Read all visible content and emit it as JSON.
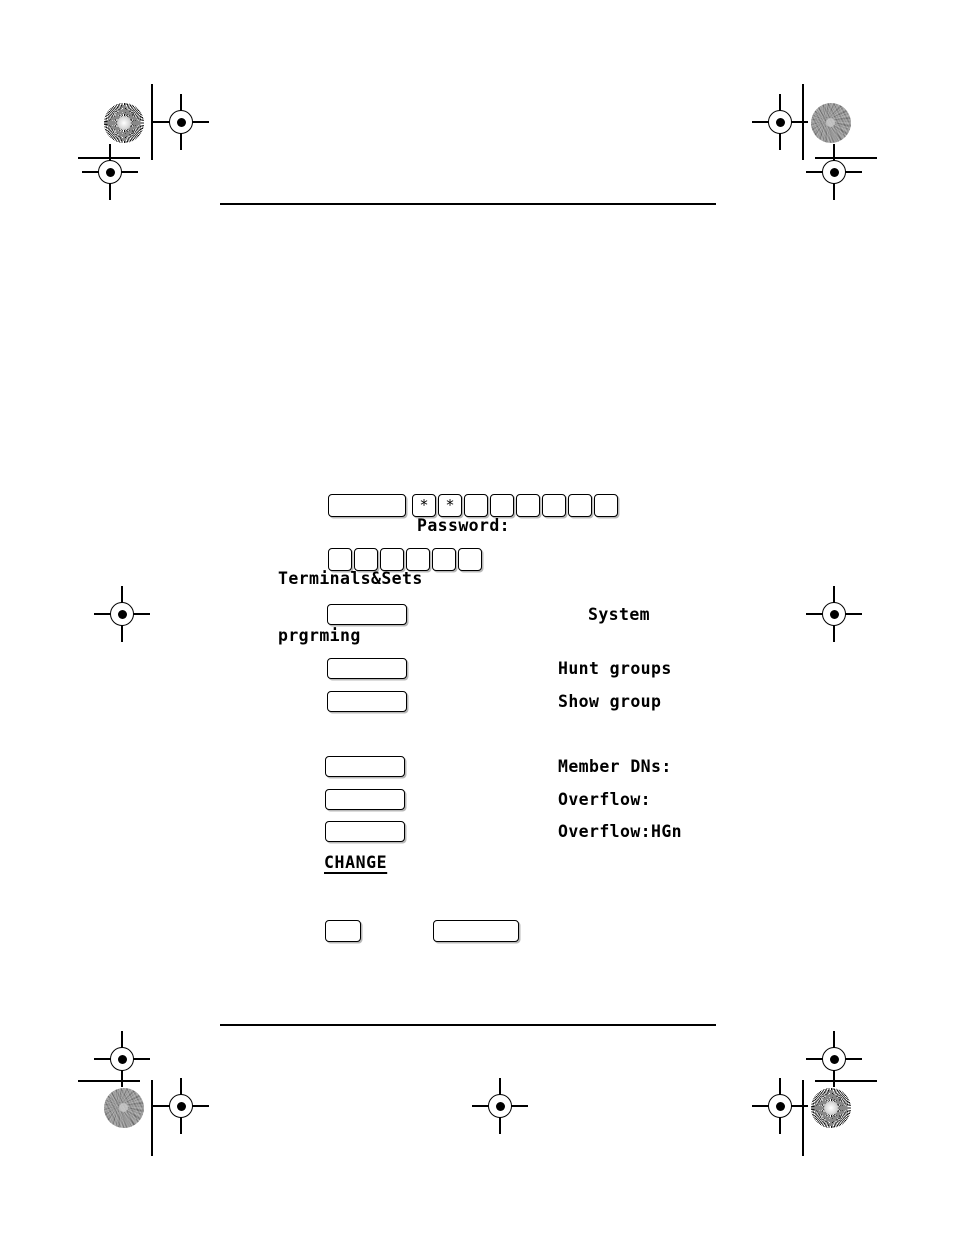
{
  "page": {
    "type": "programming-flow-diagram",
    "rules": {
      "top_label": "header-rule",
      "bottom_label": "footer-rule"
    }
  },
  "flow": {
    "password_row": {
      "feature_key_label": "",
      "digit_keys": [
        "*",
        "*",
        "",
        "",
        "",
        "",
        "",
        ""
      ],
      "display": "Password:"
    },
    "code_row": {
      "digit_keys": [
        "",
        "",
        "",
        "",
        "",
        ""
      ],
      "display": "Terminals&Sets"
    },
    "steps": [
      {
        "key_label": "",
        "display": "System",
        "display2": "prgrming"
      },
      {
        "key_label": "",
        "display": "Hunt groups"
      },
      {
        "key_label": "",
        "display": "Show group"
      },
      {
        "key_label": "",
        "display": "Member DNs:"
      },
      {
        "key_label": "",
        "display": "Overflow:"
      },
      {
        "key_label": "",
        "display": "Overflow:HGn"
      }
    ],
    "softkey": "CHANGE",
    "footer_keys": {
      "small_label": "",
      "large_label": ""
    }
  },
  "marks": {
    "target": "registration-target",
    "starburst": "starburst-density-circle",
    "noise": "mottled-density-circle",
    "trim": "trim-line"
  },
  "colors": {
    "ink": "#000000",
    "paper": "#ffffff",
    "gray": "#8d8d8d"
  }
}
